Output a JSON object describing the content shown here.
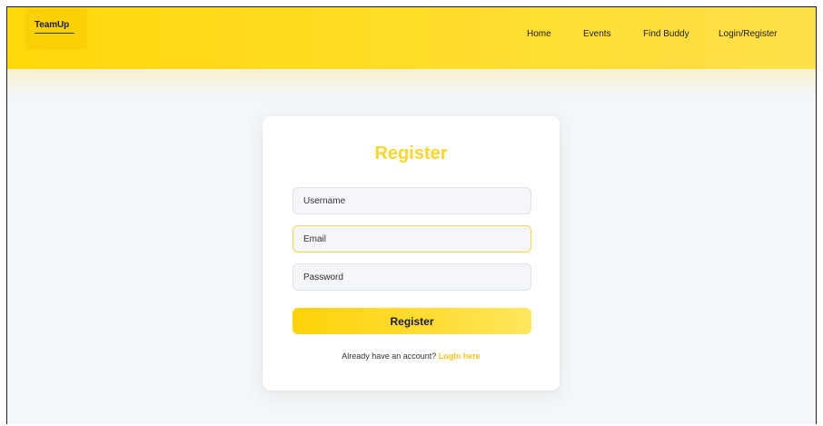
{
  "app": {
    "logo_text": "TeamUp"
  },
  "nav": {
    "home": "Home",
    "events": "Events",
    "find_buddy": "Find Buddy",
    "login_register": "Login/Register"
  },
  "form": {
    "title": "Register",
    "username_placeholder": "Username",
    "email_placeholder": "Email",
    "password_placeholder": "Password",
    "submit_label": "Register",
    "footer_text": "Already have an account? ",
    "footer_link": "Login here"
  },
  "colors": {
    "brand_yellow": "#ffd80a",
    "title_yellow": "#fcd62a",
    "link_yellow": "#f5c518",
    "background": "#f3f6fa"
  }
}
